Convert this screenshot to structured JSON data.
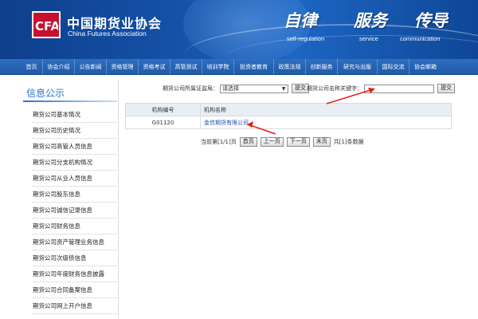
{
  "header": {
    "site_name": "中国期货业协会",
    "site_name_en": "China Futures Association",
    "slogans": [
      {
        "cn": "自律",
        "en": "self-regulation"
      },
      {
        "cn": "服务",
        "en": "service"
      },
      {
        "cn": "传导",
        "en": "communication"
      }
    ]
  },
  "nav": {
    "items": [
      "首页",
      "协会介绍",
      "公告新闻",
      "资格管理",
      "资格考试",
      "高管测试",
      "培训学院",
      "投资者教育",
      "政策法规",
      "创新服务",
      "研究与出版",
      "国际交流",
      "协会邮箱"
    ]
  },
  "sidebar": {
    "title": "信息公示",
    "items": [
      "期货公司基本情况",
      "期货公司历史情况",
      "期货公司高管人员信息",
      "期货公司分支机构情况",
      "期货公司从业人员信息",
      "期货公司股东信息",
      "期货公司诚信记录信息",
      "期货公司财务信息",
      "期货公司资产管理业务信息",
      "期货公司次级债信息",
      "期货公司年度财务信息披露",
      "期货公司合同备案信息",
      "期货公司网上开户信息"
    ]
  },
  "search": {
    "region_label": "期货公司所属证监局：",
    "region_value": "请选择",
    "submit1": "提交",
    "keyword_label": "期货公司名称关键字：",
    "keyword_value": "",
    "submit2": "提交"
  },
  "table": {
    "headers": [
      "机构编号",
      "机构名称"
    ],
    "rows": [
      {
        "id": "G01120",
        "name": "金信期货有限公司"
      }
    ]
  },
  "pager": {
    "current": "当前第[1/1]页",
    "first": "首页",
    "prev": "上一页",
    "next": "下一页",
    "last": "末页",
    "total": "共[1]条数据"
  },
  "colors": {
    "header_blue": "#1652a8",
    "nav_blue": "#1e5aa8",
    "logo_red": "#c8102e",
    "annotation_red": "#e0201b",
    "link_blue": "#1a4fb4"
  }
}
